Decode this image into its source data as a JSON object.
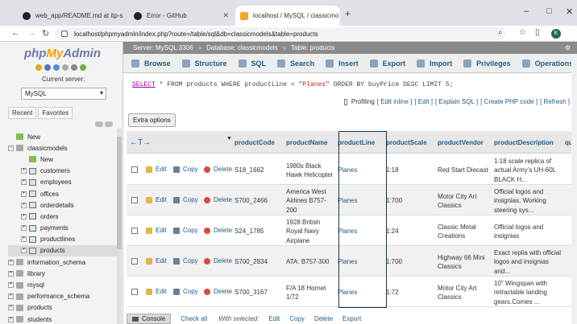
{
  "browser": {
    "tabs": [
      {
        "title": "web_app/README.md at itp-s",
        "icon": "github-icon"
      },
      {
        "title": "Error - GitHub",
        "icon": "github-icon"
      },
      {
        "title": "localhost / MySQL / classicmo",
        "icon": "phpmyadmin-icon"
      }
    ],
    "url": "localhost/phpmyadmin/index.php?route=/table/sql&db=classicmodels&table=products",
    "avatar_letter": "K",
    "window_controls": [
      "–",
      "□",
      "✕"
    ],
    "new_tab": "+"
  },
  "left": {
    "logo_php": "php",
    "logo_my": "My",
    "logo_admin": "Admin",
    "current_server_label": "Current server:",
    "server_value": "MySQL",
    "tabs": [
      "Recent",
      "Favorites"
    ],
    "tree": [
      {
        "label": "New",
        "level": 0,
        "type": "new",
        "expander": ""
      },
      {
        "label": "classicmodels",
        "level": 0,
        "type": "db",
        "expander": "−"
      },
      {
        "label": "New",
        "level": 1,
        "type": "new",
        "expander": ""
      },
      {
        "label": "customers",
        "level": 1,
        "type": "table",
        "expander": "+"
      },
      {
        "label": "employees",
        "level": 1,
        "type": "table",
        "expander": "+"
      },
      {
        "label": "offices",
        "level": 1,
        "type": "table",
        "expander": "+"
      },
      {
        "label": "orderdetails",
        "level": 1,
        "type": "table",
        "expander": "+"
      },
      {
        "label": "orders",
        "level": 1,
        "type": "table",
        "expander": "+"
      },
      {
        "label": "payments",
        "level": 1,
        "type": "table",
        "expander": "+"
      },
      {
        "label": "productlines",
        "level": 1,
        "type": "table",
        "expander": "+"
      },
      {
        "label": "products",
        "level": 1,
        "type": "table",
        "expander": "+",
        "selected": true
      },
      {
        "label": "information_schema",
        "level": 0,
        "type": "db",
        "expander": "+"
      },
      {
        "label": "library",
        "level": 0,
        "type": "db",
        "expander": "+"
      },
      {
        "label": "mysql",
        "level": 0,
        "type": "db",
        "expander": "+"
      },
      {
        "label": "performance_schema",
        "level": 0,
        "type": "db",
        "expander": "+"
      },
      {
        "label": "products",
        "level": 0,
        "type": "db",
        "expander": "+"
      },
      {
        "label": "students",
        "level": 0,
        "type": "db",
        "expander": "+"
      }
    ]
  },
  "breadcrumb": {
    "server": "Server: MySQL:3306",
    "database": "Database: classicmodels",
    "table": "Table: products",
    "sep": "»"
  },
  "menu": [
    "Browse",
    "Structure",
    "SQL",
    "Search",
    "Insert",
    "Export",
    "Import",
    "Privileges",
    "Operations"
  ],
  "menu_more": "▼ M",
  "sql": {
    "select": "SELECT",
    "p1": " * FROM products WHERE productLine = ",
    "str": "\"Planes\"",
    "p2": " ORDER BY buyPrice DESC LIMIT 5;"
  },
  "profiling": {
    "label": "Profiling",
    "links": [
      "[ Edit inline ]",
      "[ Edit ]",
      "[ Explain SQL ]",
      "[ Create PHP code ]",
      "[ Refresh ]"
    ]
  },
  "extra_options": "Extra options",
  "table": {
    "nav_arrows": "←T→",
    "sort_indicator": "▼",
    "columns": [
      "productCode",
      "productName",
      "productLine",
      "productScale",
      "productVendor",
      "productDescription",
      "qu"
    ],
    "actions": {
      "edit": "Edit",
      "copy": "Copy",
      "delete": "Delete"
    },
    "rows": [
      {
        "code": "S18_1662",
        "name": "1980s Black Hawk Helicopter",
        "line": "Planes",
        "scale": "1:18",
        "vendor": "Red Start Diecast",
        "desc": "1:18 scale replica of actual Army's UH-60L BLACK H..."
      },
      {
        "code": "S700_2466",
        "name": "America West Airlines B757-200",
        "line": "Planes",
        "scale": "1:700",
        "vendor": "Motor City Art Classics",
        "desc": "Official logos and insignias. Working steering sys..."
      },
      {
        "code": "S24_1785",
        "name": "1928 British Royal Navy Airplane",
        "line": "Planes",
        "scale": "1:24",
        "vendor": "Classic Metal Creations",
        "desc": "Official logos and insignias"
      },
      {
        "code": "S700_2834",
        "name": "ATA: B757-300",
        "line": "Planes",
        "scale": "1:700",
        "vendor": "Highway 66 Mini Classics",
        "desc": "Exact replia with official logos and insignias and..."
      },
      {
        "code": "S700_3167",
        "name": "F/A 18 Hornet 1/72",
        "line": "Planes",
        "scale": "1:72",
        "vendor": "Motor City Art Classics",
        "desc": "10\" Wingspan with retractable landing gears.Comes ..."
      }
    ]
  },
  "bottom": {
    "console": "Console",
    "check_all": "Check all",
    "with_selected": "With selected:",
    "edit": "Edit",
    "copy": "Copy",
    "delete": "Delete",
    "export": "Export"
  }
}
